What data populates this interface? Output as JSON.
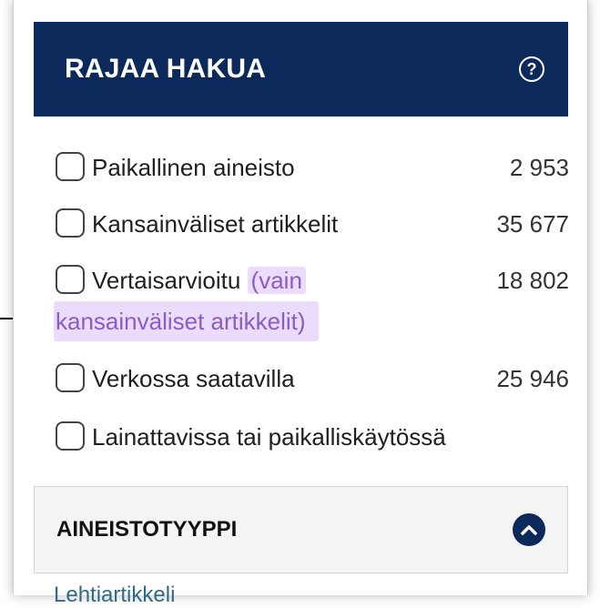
{
  "header": {
    "title": "RAJAA HAKUA",
    "help_icon": "question-circle-icon"
  },
  "filters": [
    {
      "label": "Paikallinen aineisto",
      "count": "2 953"
    },
    {
      "label": "Kansainväliset artikkelit",
      "count": "35 677"
    },
    {
      "label": "Vertaisarvioitu",
      "note_part1": "(vain",
      "note_part2": "kansainväliset artikkelit)",
      "count": "18 802"
    },
    {
      "label": "Verkossa saatavilla",
      "count": "25 946"
    },
    {
      "label": "Lainattavissa tai paikalliskäytössä",
      "count": ""
    }
  ],
  "section": {
    "title": "AINEISTOTYYPPI",
    "icon": "chevron-up-circle-icon"
  },
  "next_item_partial": "Lehtiartikkeli",
  "colors": {
    "header_bg": "#0b2a5b",
    "highlight_bg": "#ecdcfb",
    "highlight_text": "#8a5cc6"
  }
}
